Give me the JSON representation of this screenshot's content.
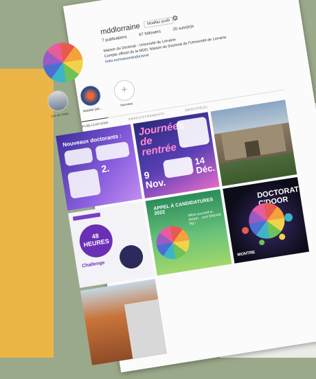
{
  "profile": {
    "username": "mddlorraine",
    "edit_button": "Modifier profil",
    "stats": [
      "7 publications",
      "67 followers",
      "20 suivi(e)s"
    ],
    "bio_line1": "Maison du Doctorat - Université de Lorraine",
    "bio_line2": "Compte officiel de la MDD, Maison du Doctorat de l'Université de Lorraine",
    "bio_link": "linktr.ee/maisondudoctorat"
  },
  "highlights": [
    {
      "label": "Les de Vidéo"
    },
    {
      "label": "Mobilité DrE..."
    },
    {
      "label": "Nouveau"
    }
  ],
  "tabs": [
    "PUBLICATIONS",
    "ENREGISTREMENTS",
    "IDENTIFIÉ(E)"
  ],
  "posts": {
    "p1_title": "Nouveaux doctorants :",
    "p1_step": "2.",
    "p2_title": "Journées de rentrée",
    "p2_date_left": "9 Nov.",
    "p2_date_right": "14 Déc.",
    "p4_big": "48 HEURES",
    "p4_sub": "Challenge",
    "p5_title": "APPEL À CANDIDATURES 2022",
    "p5_sub": "Allow yourself to dream... and DREAM big !",
    "p6_title": "DOCTORAT C'DOOR",
    "p6_sub": "MONTRE"
  },
  "colors": {
    "sage": "#9ba98b",
    "yellow": "#ecb548",
    "link": "#274b80"
  }
}
